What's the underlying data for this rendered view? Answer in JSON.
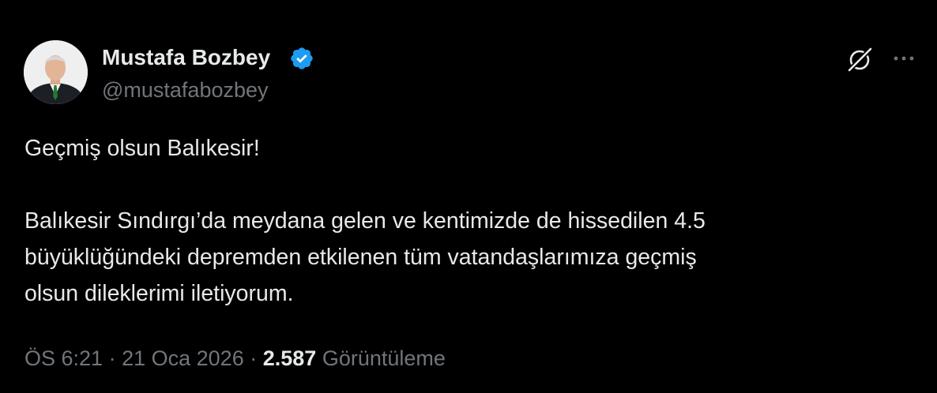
{
  "author": {
    "display_name": "Mustafa Bozbey",
    "handle": "@mustafabozbey",
    "verified": true,
    "avatar": "profile-photo"
  },
  "icons": {
    "verified": "verified-badge-icon",
    "grok": "grok-icon",
    "more": "more-options-icon"
  },
  "tweet": {
    "line1": "Geçmiş olsun Balıkesir!",
    "line2": "Balıkesir Sındırgı’da meydana gelen ve kentimizde de hissedilen 4.5",
    "line3": "büyüklüğündeki depremden etkilenen tüm vatandaşlarımıza geçmiş",
    "line4": "olsun dileklerimi iletiyorum."
  },
  "meta": {
    "time": "ÖS 6:21",
    "separator": "·",
    "date": "21 Oca 2026",
    "views_count": "2.587",
    "views_label": "Görüntüleme"
  },
  "colors": {
    "background": "#000000",
    "primary_text": "#e7e9ea",
    "secondary_text": "#71767b",
    "verified_blue": "#1d9bf0"
  }
}
